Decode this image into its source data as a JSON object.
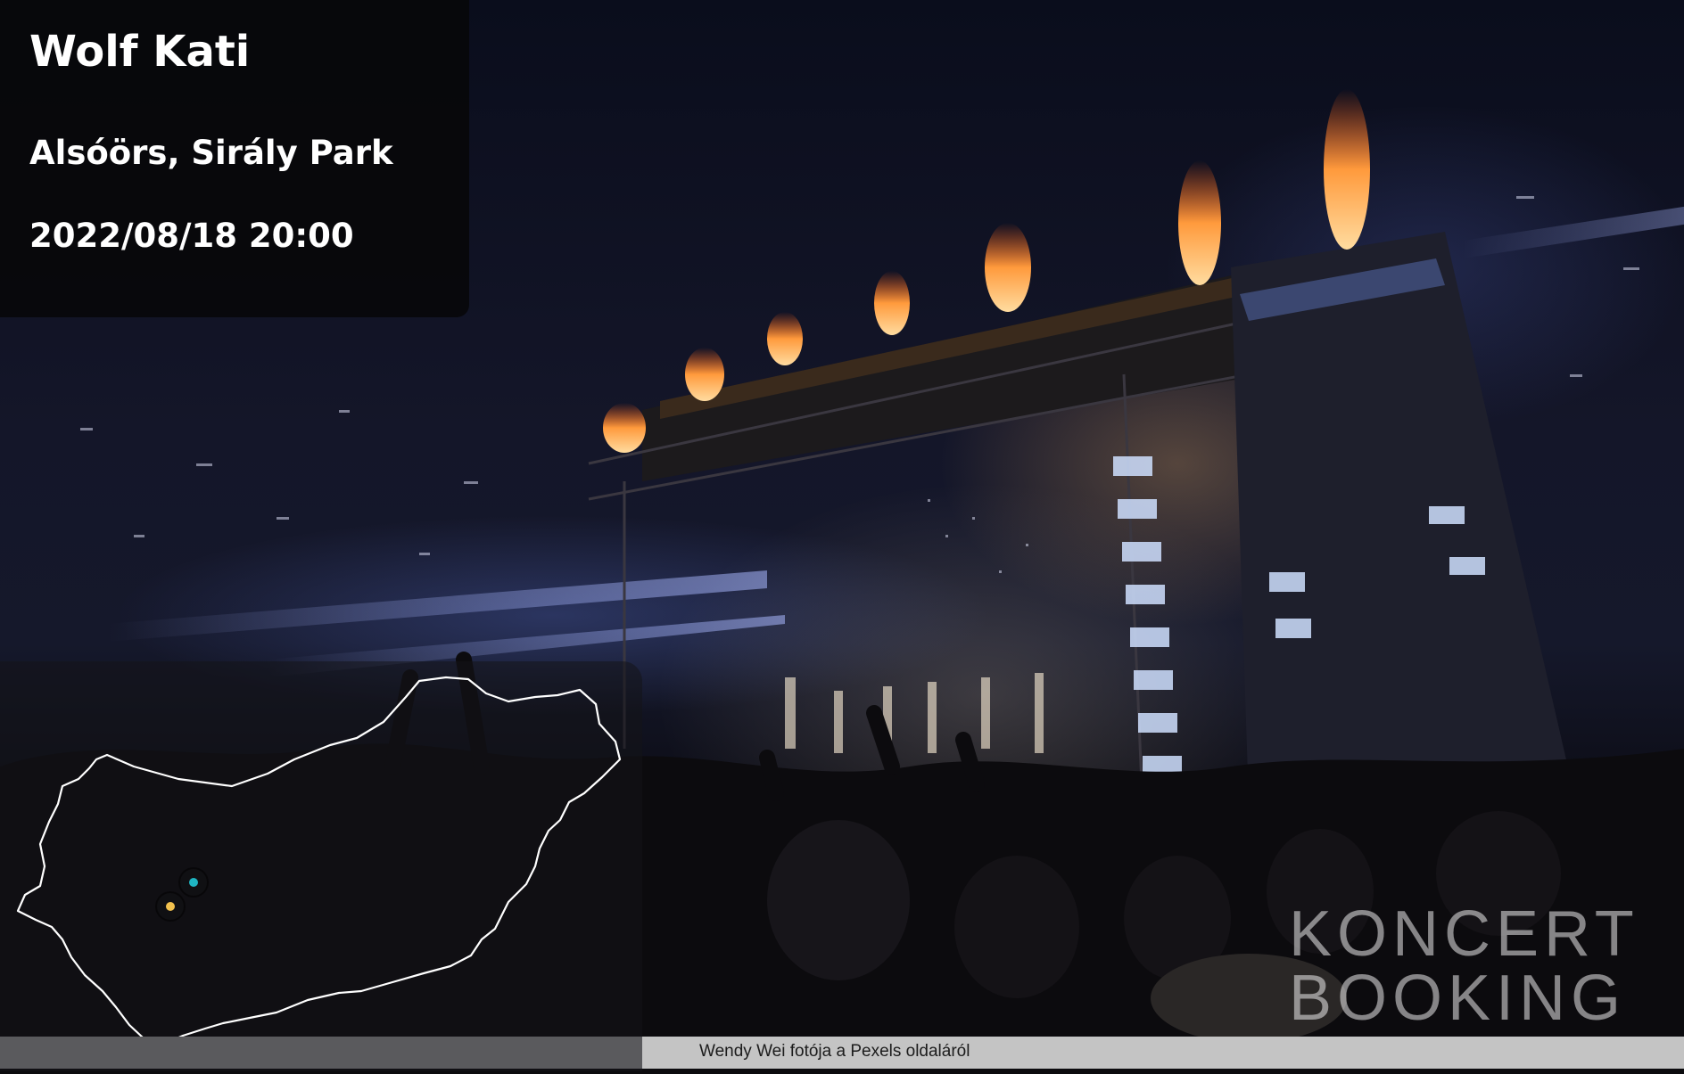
{
  "event": {
    "artist": "Wolf Kati",
    "venue": "Alsóörs, Sirály Park",
    "datetime": "2022/08/18 20:00"
  },
  "map": {
    "pins": [
      {
        "name": "pin-teal",
        "color": "#1fb5c2"
      },
      {
        "name": "pin-yellow",
        "color": "#f2c14e"
      }
    ]
  },
  "credit": "Wendy Wei fotója a Pexels oldaláról",
  "logo": {
    "line1": "KONCERT",
    "line2": "BOOKING"
  },
  "colors": {
    "panel": "#08080a",
    "text": "#ffffff",
    "credit_bar_left": "#5a5a5d",
    "credit_bar_right": "#c4c4c4"
  }
}
